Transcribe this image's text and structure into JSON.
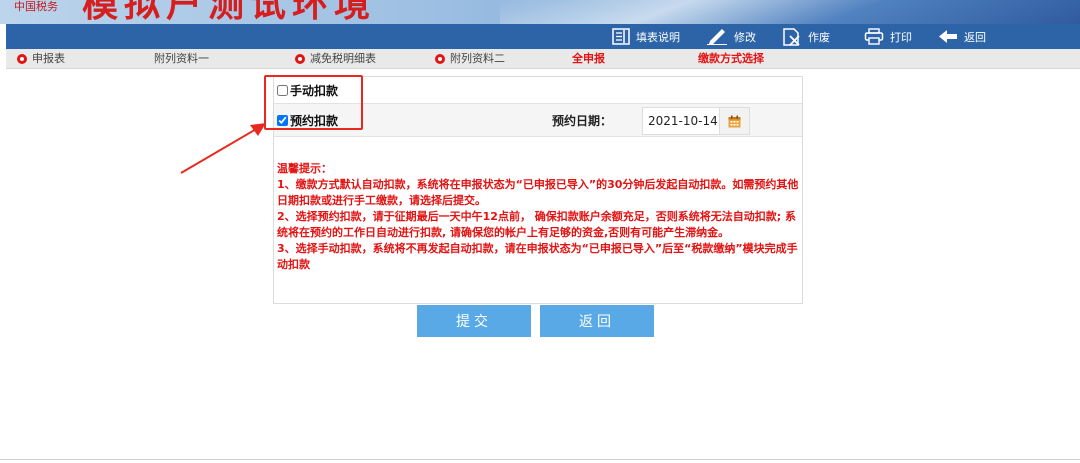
{
  "banner": {
    "logo_text": "中国税务",
    "title": "模拟户测试环境"
  },
  "toolbar": {
    "items": [
      {
        "label": "填表说明",
        "icon": "doc-help-icon"
      },
      {
        "label": "修改",
        "icon": "pencil-icon"
      },
      {
        "label": "作废",
        "icon": "void-doc-icon"
      },
      {
        "label": "打印",
        "icon": "printer-icon"
      },
      {
        "label": "返回",
        "icon": "back-arrow-icon"
      }
    ]
  },
  "tabs": [
    {
      "label": "申报表",
      "gear": true
    },
    {
      "label": "附列资料一",
      "gear": false
    },
    {
      "label": "减免税明细表",
      "gear": true
    },
    {
      "label": "附列资料二",
      "gear": true
    },
    {
      "label": "全申报",
      "gear": false
    },
    {
      "label": "缴款方式选择",
      "gear": false
    }
  ],
  "form": {
    "manual_deduction": {
      "label": "手动扣款",
      "checked": false
    },
    "scheduled_deduction": {
      "label": "预约扣款",
      "checked": true
    },
    "date_label": "预约日期：",
    "date_value": "2021-10-14"
  },
  "tips": {
    "title": "温馨提示：",
    "line1": "1、缴款方式默认自动扣款，系统将在申报状态为“已申报已导入”的30分钟后发起自动扣款。如需预约其他日期扣款或进行手工缴款，请选择后提交。",
    "line2": "2、选择预约扣款，请于征期最后一天中午12点前， 确保扣款账户余额充足，否则系统将无法自动扣款; 系统将在预约的工作日自动进行扣款, 请确保您的帐户上有足够的资金,否则有可能产生滞纳金。",
    "line3": "3、选择手动扣款，系统将不再发起自动扣款，请在申报状态为“已申报已导入”后至“税款缴纳”模块完成手动扣款"
  },
  "buttons": {
    "submit": "提交",
    "back": "返回"
  },
  "colors": {
    "toolbar_bg": "#2d64a8",
    "button_bg": "#58a9e6",
    "alert_red": "#e31313",
    "highlight_red": "#e8291f"
  }
}
